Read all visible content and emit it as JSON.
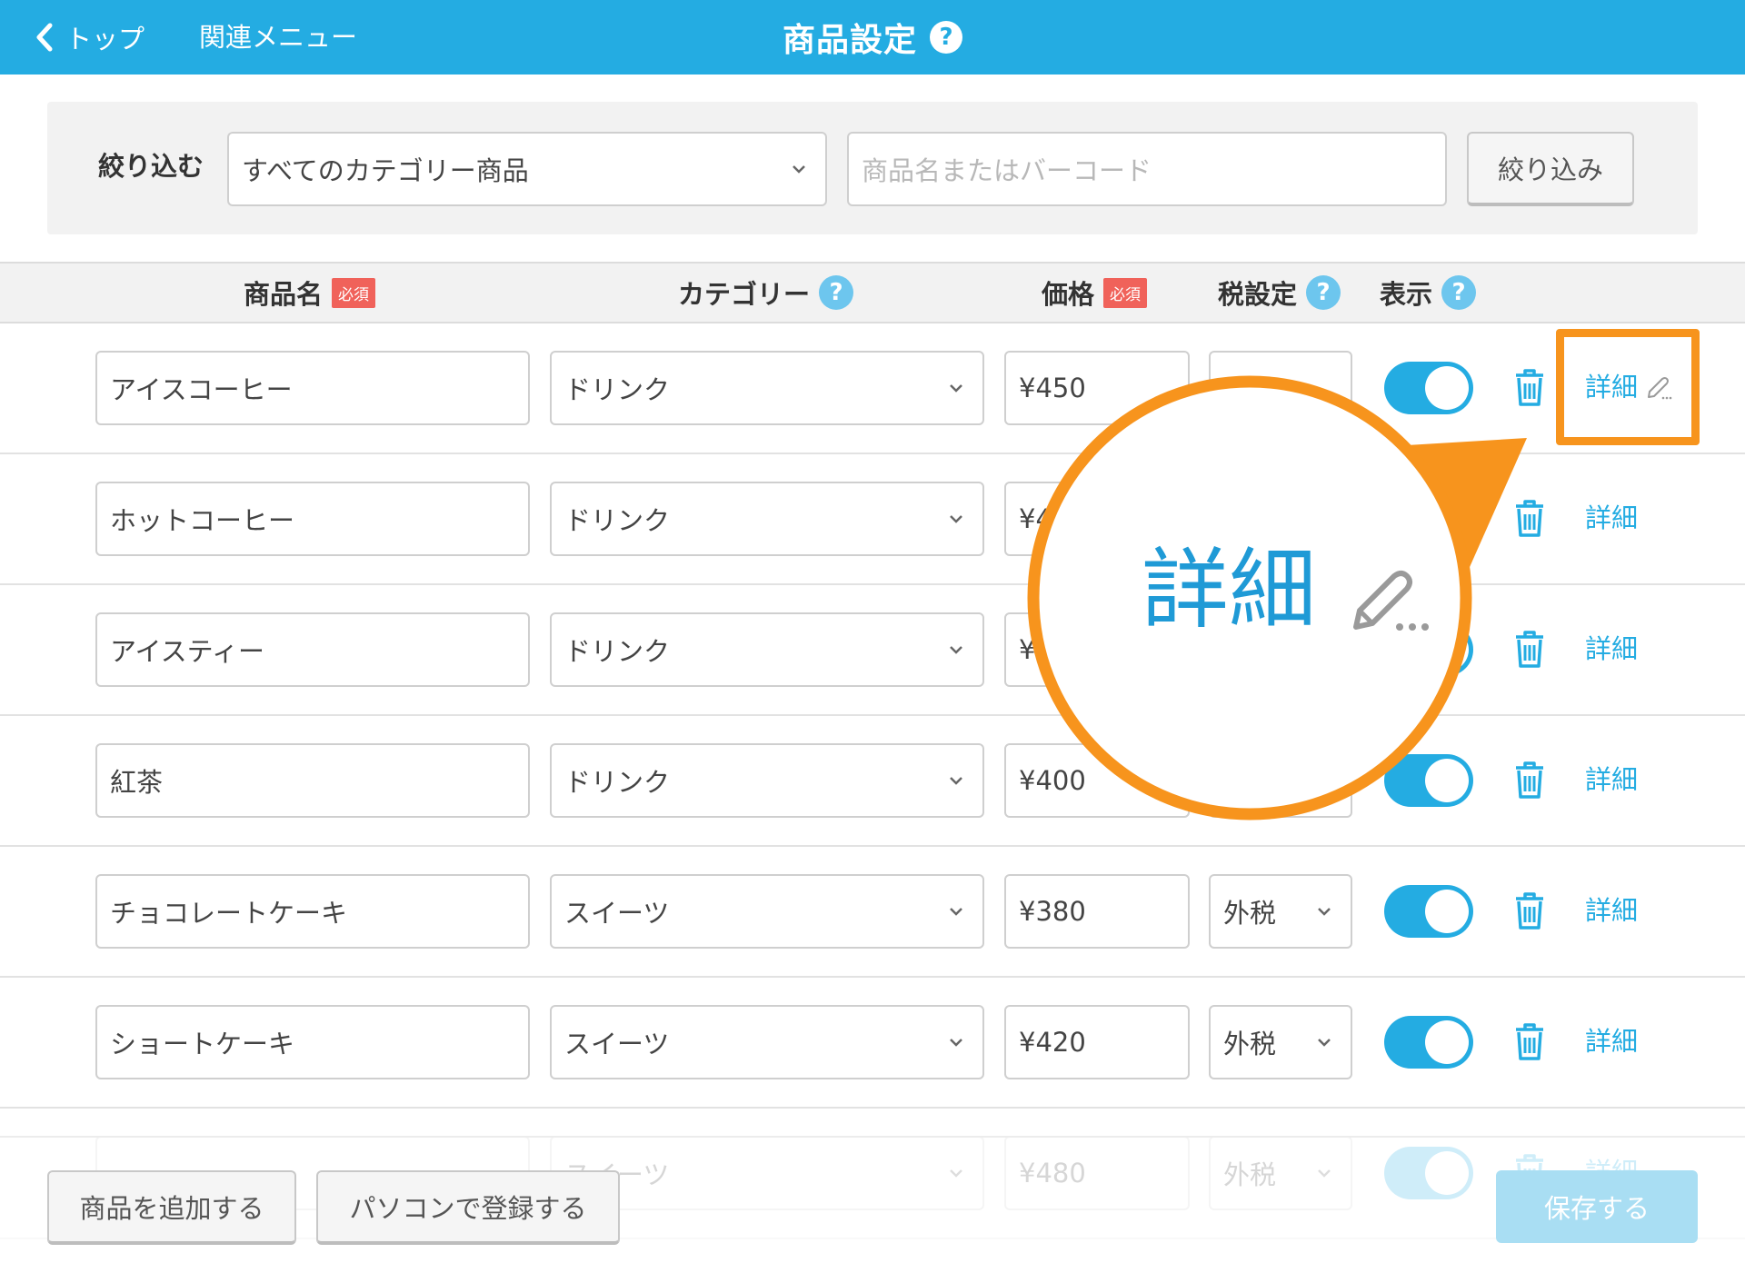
{
  "header": {
    "back_label": "トップ",
    "related_label": "関連メニュー",
    "title": "商品設定",
    "help_glyph": "?"
  },
  "filter": {
    "label": "絞り込む",
    "category_value": "すべてのカテゴリー商品",
    "search_placeholder": "商品名またはバーコード",
    "apply_label": "絞り込み"
  },
  "columns": {
    "name": "商品名",
    "category": "カテゴリー",
    "price": "価格",
    "tax": "税設定",
    "display": "表示",
    "required_badge": "必須",
    "help_glyph": "?"
  },
  "rows": [
    {
      "name": "アイスコーヒー",
      "category": "ドリンク",
      "price": "¥450",
      "tax": "",
      "visible": true,
      "detail": "詳細"
    },
    {
      "name": "ホットコーヒー",
      "category": "ドリンク",
      "price": "¥40",
      "tax": "",
      "visible": true,
      "detail": "詳細"
    },
    {
      "name": "アイスティー",
      "category": "ドリンク",
      "price": "¥4",
      "tax": "",
      "visible": true,
      "detail": "詳細"
    },
    {
      "name": "紅茶",
      "category": "ドリンク",
      "price": "¥400",
      "tax": "",
      "visible": true,
      "detail": "詳細"
    },
    {
      "name": "チョコレートケーキ",
      "category": "スイーツ",
      "price": "¥380",
      "tax": "外税",
      "visible": true,
      "detail": "詳細"
    },
    {
      "name": "ショートケーキ",
      "category": "スイーツ",
      "price": "¥420",
      "tax": "外税",
      "visible": true,
      "detail": "詳細"
    },
    {
      "name": "",
      "category": "スイーツ",
      "price": "¥480",
      "tax": "外税",
      "visible": true,
      "detail": "詳細"
    }
  ],
  "footer": {
    "add_label": "商品を追加する",
    "pc_label": "パソコンで登録する",
    "save_label": "保存する"
  },
  "callout": {
    "zoom_label": "詳細"
  },
  "colors": {
    "accent": "#24ace2",
    "highlight": "#f7941d",
    "required": "#f0625a"
  },
  "icons": [
    "chevron-left-icon",
    "help-icon",
    "chevron-down-icon",
    "trash-icon",
    "pencil-icon"
  ]
}
